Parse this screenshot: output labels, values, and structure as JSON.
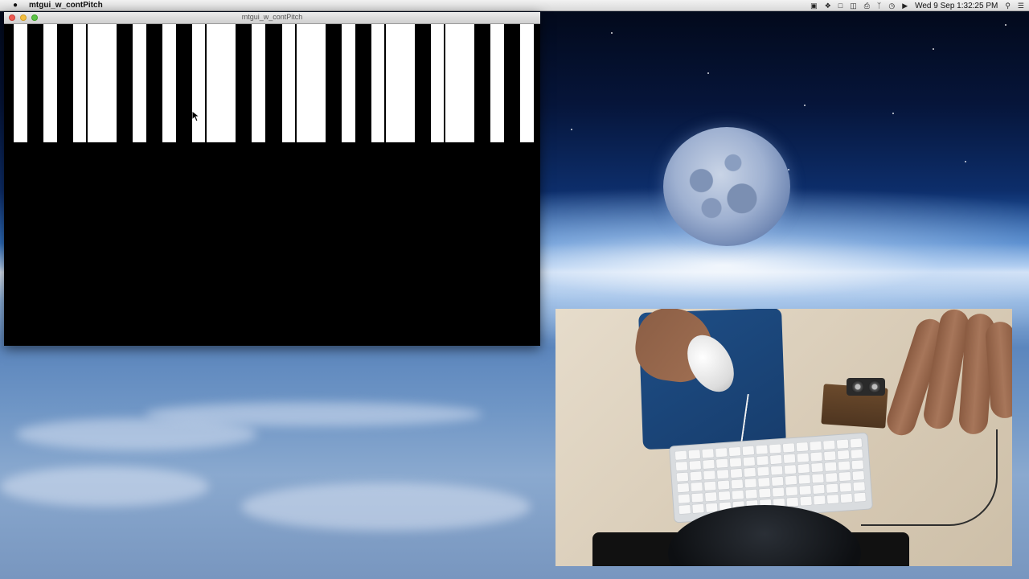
{
  "menubar": {
    "app_name": "mtgui_w_contPitch",
    "clock": "Wed 9 Sep  1:32:25 PM",
    "status_icons": [
      "camera-icon",
      "dropbox-icon",
      "clipboard-icon",
      "notes-icon",
      "printer-icon",
      "bluetooth-icon",
      "time-machine-icon",
      "volume-icon"
    ],
    "right_icons": [
      "spotlight-icon",
      "notification-center-icon"
    ]
  },
  "window": {
    "title": "mtgui_w_contPitch",
    "keys": {
      "count": 18,
      "divider_after": [
        2,
        6,
        9,
        12,
        14
      ]
    }
  },
  "colors": {
    "key_white": "#ffffff",
    "key_black": "#000000",
    "close": "#ee5a52",
    "minimize": "#f4be3e",
    "zoom": "#5cc447"
  }
}
